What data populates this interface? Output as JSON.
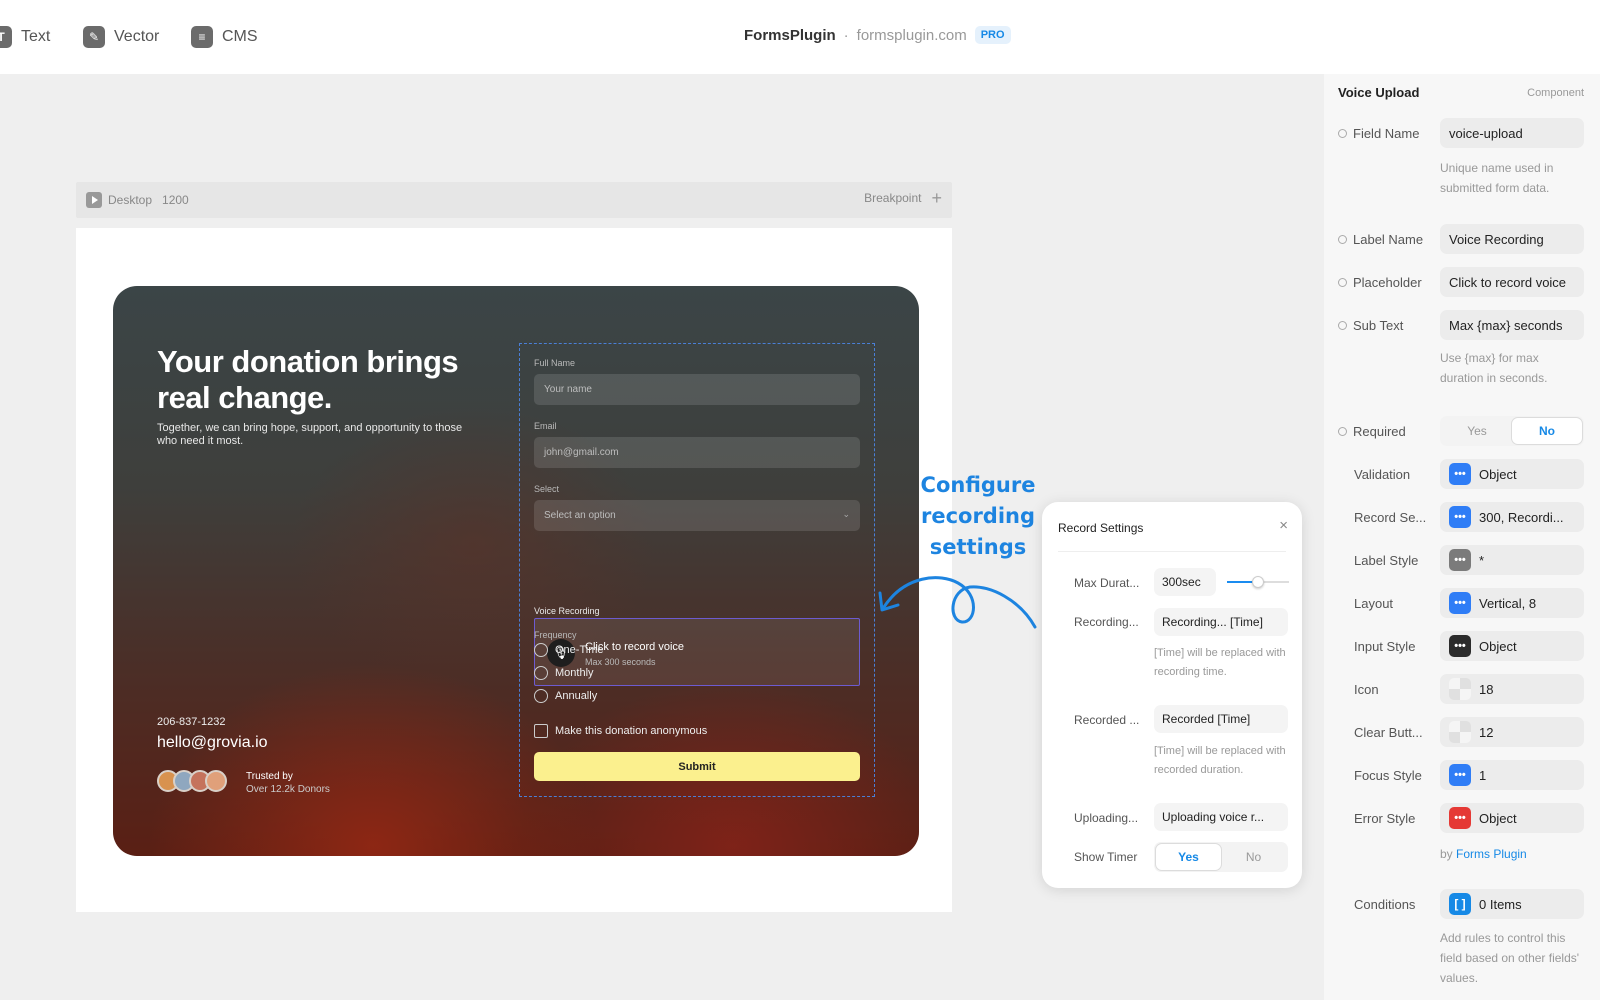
{
  "toolbar": {
    "items": [
      {
        "label": "Text",
        "icon": "T"
      },
      {
        "label": "Vector",
        "icon": "✎"
      },
      {
        "label": "CMS",
        "icon": "≡"
      }
    ]
  },
  "brand": {
    "name": "FormsPlugin",
    "separator": "·",
    "domain": "formsplugin.com",
    "badge": "PRO"
  },
  "frame": {
    "device": "Desktop",
    "width": "1200",
    "breakpoint_label": "Breakpoint",
    "add_symbol": "+"
  },
  "hero": {
    "headline": "Your donation brings real change.",
    "subline": "Together, we can bring hope, support, and opportunity to those who need it most.",
    "phone": "206-837-1232",
    "email": "hello@grovia.io",
    "trusted_title": "Trusted by",
    "trusted_sub": "Over 12.2k Donors"
  },
  "form": {
    "full_name_label": "Full Name",
    "full_name_placeholder": "Your name",
    "email_label": "Email",
    "email_placeholder": "john@gmail.com",
    "select_label": "Select",
    "select_placeholder": "Select an option",
    "voice_label": "Voice Recording",
    "voice_title": "Click to record voice",
    "voice_sub": "Max 300 seconds",
    "frequency_label": "Frequency",
    "frequency_options": [
      "One-Time",
      "Monthly",
      "Annually"
    ],
    "anonymous_label": "Make this donation anonymous",
    "submit_label": "Submit"
  },
  "annotation": {
    "line1": "Configure",
    "line2": "recording",
    "line3": "settings"
  },
  "record_settings": {
    "title": "Record Settings",
    "close": "×",
    "max_duration_label": "Max Durat...",
    "max_duration_value": "300sec",
    "max_duration_fraction": 0.5,
    "recording_label": "Recording...",
    "recording_value": "Recording... [Time]",
    "recording_hint": "[Time] will be replaced with recording time.",
    "recorded_label": "Recorded ...",
    "recorded_value": "Recorded [Time]",
    "recorded_hint": "[Time] will be replaced with recorded duration.",
    "uploading_label": "Uploading...",
    "uploading_value": "Uploading voice r...",
    "show_timer_label": "Show Timer",
    "show_timer_yes": "Yes",
    "show_timer_no": "No"
  },
  "panel": {
    "title": "Voice Upload",
    "type": "Component",
    "field_name_label": "Field Name",
    "field_name_value": "voice-upload",
    "field_name_help": "Unique name used in submitted form data.",
    "label_name_label": "Label Name",
    "label_name_value": "Voice Recording",
    "placeholder_label": "Placeholder",
    "placeholder_value": "Click to record voice",
    "subtext_label": "Sub Text",
    "subtext_value": "Max {max} seconds",
    "subtext_help": "Use {max} for max duration in seconds.",
    "required_label": "Required",
    "required_yes": "Yes",
    "required_no": "No",
    "validation_label": "Validation",
    "validation_value": "Object",
    "record_settings_label": "Record Se...",
    "record_settings_value": "300, Recordi...",
    "label_style_label": "Label Style",
    "label_style_value": "*",
    "layout_label": "Layout",
    "layout_value": "Vertical, 8",
    "input_style_label": "Input Style",
    "input_style_value": "Object",
    "icon_label": "Icon",
    "icon_value": "18",
    "clear_button_label": "Clear Butt...",
    "clear_button_value": "12",
    "focus_style_label": "Focus Style",
    "focus_style_value": "1",
    "error_style_label": "Error Style",
    "error_style_value": "Object",
    "by_prefix": "by",
    "by_link": "Forms Plugin",
    "conditions_label": "Conditions",
    "conditions_value": "0 Items",
    "conditions_symbol": "[ ]",
    "conditions_help": "Add rules to control this field based on other fields' values.",
    "dots": "•••"
  },
  "colors": {
    "accent": "#1689e6",
    "submit": "#fbf08e",
    "error": "#e53935",
    "object_blue": "#2f7df6",
    "dark_button": "#2b2b2b",
    "grey_button": "#7b7b7b"
  }
}
